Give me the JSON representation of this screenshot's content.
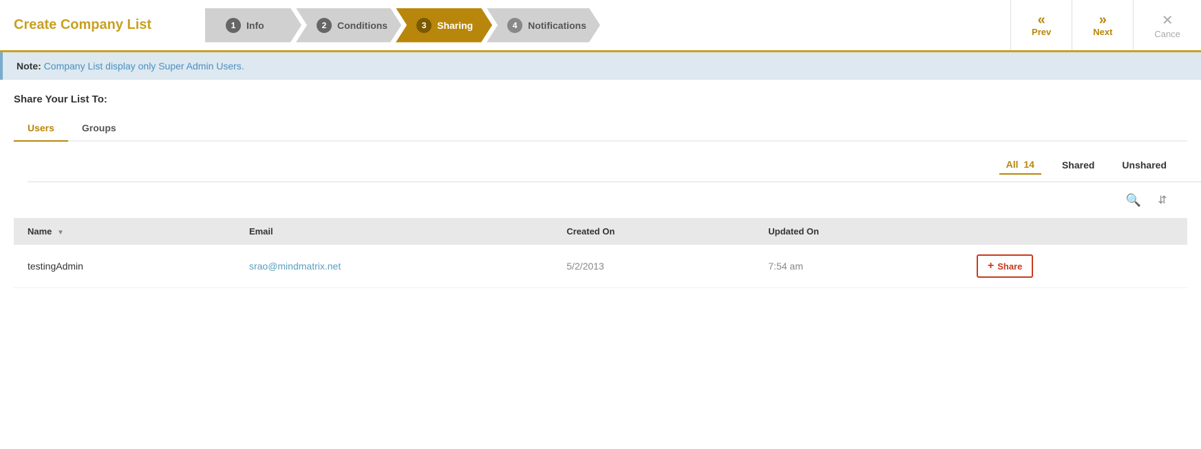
{
  "header": {
    "title": "Create Company List",
    "prev_label": "Prev",
    "next_label": "Next",
    "cancel_label": "Cance"
  },
  "steps": [
    {
      "num": "1",
      "label": "Info",
      "state": "completed"
    },
    {
      "num": "2",
      "label": "Conditions",
      "state": "completed"
    },
    {
      "num": "3",
      "label": "Sharing",
      "state": "active"
    },
    {
      "num": "4",
      "label": "Notifications",
      "state": "default"
    }
  ],
  "note": {
    "label": "Note:",
    "text": "Company List display only Super Admin Users."
  },
  "share_section": {
    "title": "Share Your List To:",
    "tabs": [
      {
        "label": "Users",
        "active": true
      },
      {
        "label": "Groups",
        "active": false
      }
    ],
    "filters": [
      {
        "label": "All",
        "count": "14",
        "active": true
      },
      {
        "label": "Shared",
        "count": "",
        "active": false
      },
      {
        "label": "Unshared",
        "count": "",
        "active": false
      }
    ],
    "table": {
      "columns": [
        "Name",
        "Email",
        "Created On",
        "Updated On",
        ""
      ],
      "rows": [
        {
          "name": "testingAdmin",
          "email": "srao@mindmatrix.net",
          "created_on": "5/2/2013",
          "updated_on": "7:54 am",
          "action": "+ Share"
        }
      ]
    }
  }
}
